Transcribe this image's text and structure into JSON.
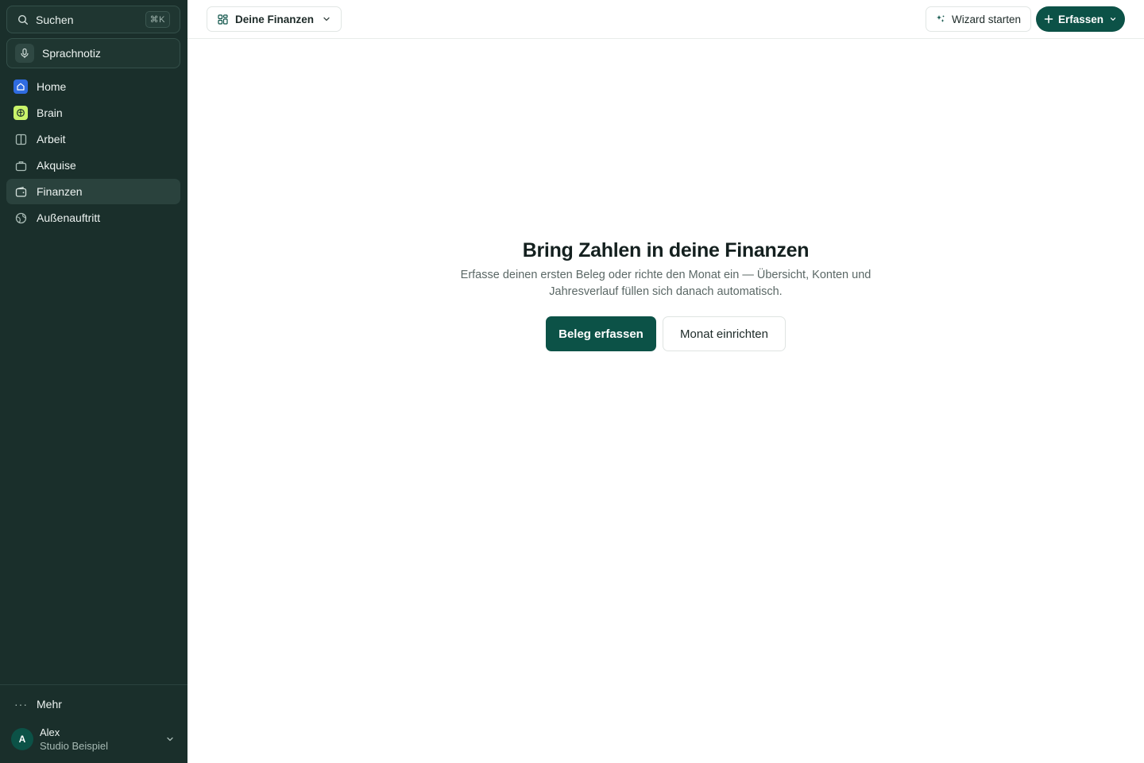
{
  "sidebar": {
    "search": {
      "label": "Suchen",
      "shortcut": "⌘K",
      "icon": "search-icon"
    },
    "voice_note": {
      "label": "Sprachnotiz",
      "icon": "microphone-icon"
    },
    "items": [
      {
        "label": "Home",
        "icon": "home-icon",
        "icon_bg": "#2f6be0",
        "active": false
      },
      {
        "label": "Brain",
        "icon": "brain-icon",
        "icon_bg": "#c9f36a",
        "active": false
      },
      {
        "label": "Arbeit",
        "icon": "columns-icon",
        "active": false
      },
      {
        "label": "Akquise",
        "icon": "briefcase-icon",
        "active": false
      },
      {
        "label": "Finanzen",
        "icon": "wallet-icon",
        "active": true
      },
      {
        "label": "Außenauftritt",
        "icon": "globe-icon",
        "active": false
      }
    ],
    "more": {
      "label": "Mehr",
      "icon": "more-dots-icon"
    },
    "account": {
      "initial": "A",
      "name": "Alex",
      "org": "Studio Beispiel"
    }
  },
  "topbar": {
    "view_select": {
      "label": "Deine Finanzen",
      "icon": "grid-icon"
    },
    "wizard_button": {
      "label": "Wizard starten",
      "icon": "sparkle-icon"
    },
    "capture_button": {
      "label": "Erfassen",
      "icon": "plus-icon"
    }
  },
  "empty_state": {
    "title": "Bring Zahlen in deine Finanzen",
    "description_line1": "Erfasse deinen ersten Beleg oder richte den Monat ein — Übersicht, Konten und",
    "description_line2": "Jahresverlauf füllen sich danach automatisch.",
    "primary_action": "Beleg erfassen",
    "secondary_action": "Monat einrichten"
  },
  "colors": {
    "sidebar_bg": "#1a2f2b",
    "accent": "#0c5247",
    "home_icon_bg": "#2f6be0",
    "brain_icon_bg": "#c9f36a"
  }
}
